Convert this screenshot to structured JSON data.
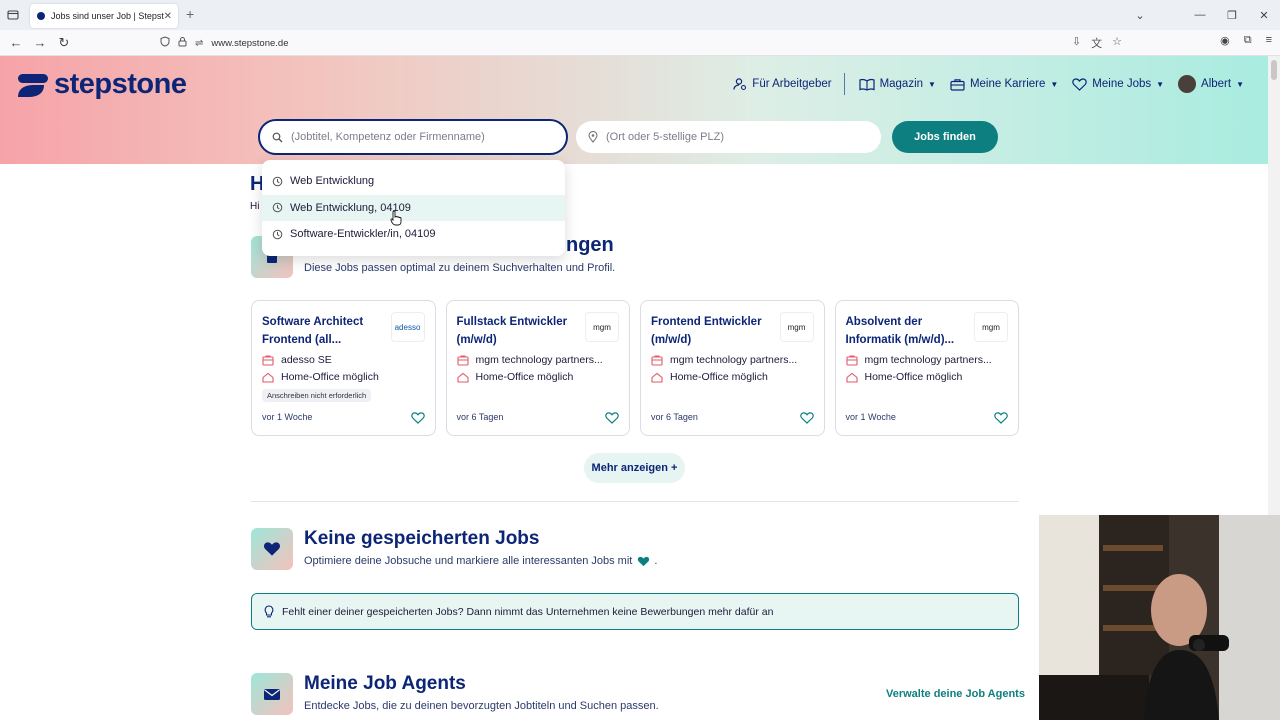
{
  "browser": {
    "tab_title": "Jobs sind unser Job | Stepstone",
    "url": "www.stepstone.de"
  },
  "header": {
    "logo_text": "stepstone",
    "nav": {
      "employer": "Für Arbeitgeber",
      "magazine": "Magazin",
      "career": "Meine Karriere",
      "jobs": "Meine Jobs",
      "user": "Albert"
    }
  },
  "search": {
    "what_placeholder": "(Jobtitel, Kompetenz oder Firmenname)",
    "where_placeholder": "(Ort oder 5-stellige PLZ)",
    "button": "Jobs finden",
    "suggestions": [
      "Web Entwicklung",
      "Web Entwicklung, 04109",
      "Software-Entwickler/in, 04109"
    ]
  },
  "hidden_section": {
    "heading_fragment": "H",
    "sub_fragment": "Hi"
  },
  "recommendations": {
    "heading_tail": "ngen",
    "subtitle": "Diese Jobs passen optimal zu deinem Suchverhalten und Profil.",
    "more_button": "Mehr anzeigen +",
    "cards": [
      {
        "title": "Software Architect Frontend (all...",
        "company": "adesso SE",
        "logo": "adesso",
        "remote": "Home-Office möglich",
        "badge": "Anschreiben nicht erforderlich",
        "age": "vor 1 Woche"
      },
      {
        "title": "Fullstack Entwickler (m/w/d)",
        "company": "mgm technology partners...",
        "logo": "mgm",
        "remote": "Home-Office möglich",
        "badge": "",
        "age": "vor 6 Tagen"
      },
      {
        "title": "Frontend Entwickler (m/w/d)",
        "company": "mgm technology partners...",
        "logo": "mgm",
        "remote": "Home-Office möglich",
        "badge": "",
        "age": "vor 6 Tagen"
      },
      {
        "title": "Absolvent der Informatik (m/w/d)...",
        "company": "mgm technology partners...",
        "logo": "mgm",
        "remote": "Home-Office möglich",
        "badge": "",
        "age": "vor 1 Woche"
      }
    ]
  },
  "saved_jobs": {
    "heading": "Keine gespeicherten Jobs",
    "subtitle_before": "Optimiere deine Jobsuche und markiere alle interessanten Jobs mit",
    "subtitle_after": ".",
    "info": "Fehlt einer deiner gespeicherten Jobs? Dann nimmt das Unternehmen keine Bewerbungen mehr dafür an"
  },
  "job_agents": {
    "heading": "Meine Job Agents",
    "subtitle": "Entdecke Jobs, die zu deinen bevorzugten Jobtiteln und Suchen passen.",
    "manage_link": "Verwalte deine Job Agents"
  },
  "colors": {
    "brand_navy": "#0c2577",
    "brand_teal": "#0e7f80",
    "icon_red": "#e05a6a"
  }
}
